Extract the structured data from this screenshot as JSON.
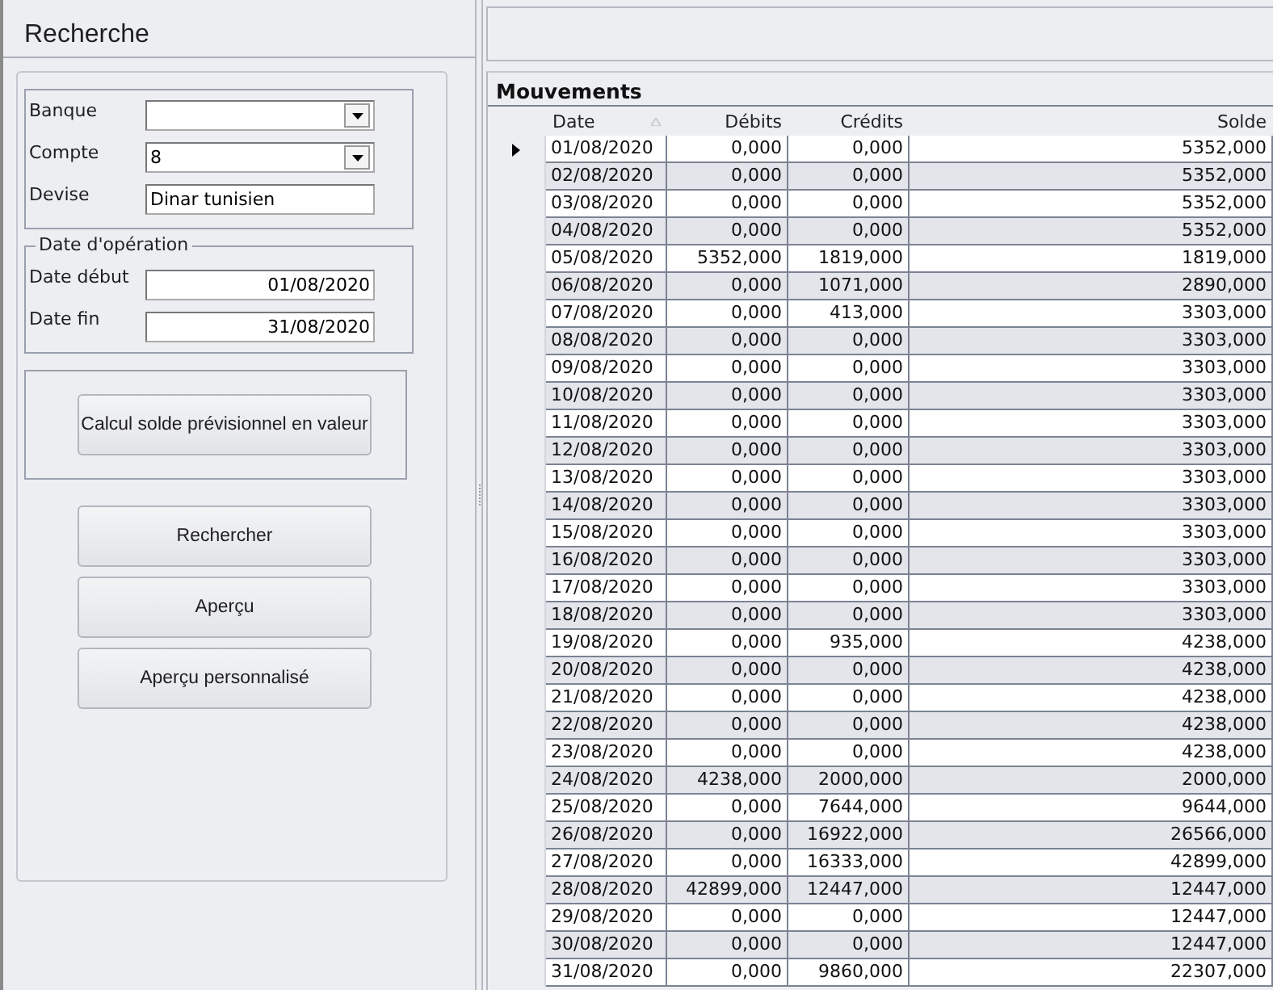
{
  "search_panel": {
    "title": "Recherche",
    "fields": [
      {
        "label": "Banque",
        "kind": "dropdown"
      },
      {
        "label": "Compte",
        "kind": "dropdown",
        "value": "8"
      },
      {
        "label": "Devise",
        "kind": "text",
        "value": "Dinar tunisien"
      }
    ],
    "date_group": {
      "legend": "Date d'opération",
      "fields": [
        {
          "label": "Date début",
          "value": "01/08/2020"
        },
        {
          "label": "Date fin",
          "value": "31/08/2020"
        }
      ]
    },
    "calc_button": "Calcul solde prévisionnel en valeur",
    "buttons": [
      "Rechercher",
      "Aperçu",
      "Aperçu personnalisé"
    ]
  },
  "table": {
    "title": "Mouvements",
    "columns": [
      "Date",
      "Débits",
      "Crédits",
      "Solde"
    ],
    "rows": [
      {
        "cells": [
          "01/08/2020",
          "0,000",
          "0,000",
          "5352,000"
        ],
        "current": true
      },
      {
        "cells": [
          "02/08/2020",
          "0,000",
          "0,000",
          "5352,000"
        ],
        "current": false
      },
      {
        "cells": [
          "03/08/2020",
          "0,000",
          "0,000",
          "5352,000"
        ],
        "current": false
      },
      {
        "cells": [
          "04/08/2020",
          "0,000",
          "0,000",
          "5352,000"
        ],
        "current": false
      },
      {
        "cells": [
          "05/08/2020",
          "5352,000",
          "1819,000",
          "1819,000"
        ],
        "current": false
      },
      {
        "cells": [
          "06/08/2020",
          "0,000",
          "1071,000",
          "2890,000"
        ],
        "current": false
      },
      {
        "cells": [
          "07/08/2020",
          "0,000",
          "413,000",
          "3303,000"
        ],
        "current": false
      },
      {
        "cells": [
          "08/08/2020",
          "0,000",
          "0,000",
          "3303,000"
        ],
        "current": false
      },
      {
        "cells": [
          "09/08/2020",
          "0,000",
          "0,000",
          "3303,000"
        ],
        "current": false
      },
      {
        "cells": [
          "10/08/2020",
          "0,000",
          "0,000",
          "3303,000"
        ],
        "current": false
      },
      {
        "cells": [
          "11/08/2020",
          "0,000",
          "0,000",
          "3303,000"
        ],
        "current": false
      },
      {
        "cells": [
          "12/08/2020",
          "0,000",
          "0,000",
          "3303,000"
        ],
        "current": false
      },
      {
        "cells": [
          "13/08/2020",
          "0,000",
          "0,000",
          "3303,000"
        ],
        "current": false
      },
      {
        "cells": [
          "14/08/2020",
          "0,000",
          "0,000",
          "3303,000"
        ],
        "current": false
      },
      {
        "cells": [
          "15/08/2020",
          "0,000",
          "0,000",
          "3303,000"
        ],
        "current": false
      },
      {
        "cells": [
          "16/08/2020",
          "0,000",
          "0,000",
          "3303,000"
        ],
        "current": false
      },
      {
        "cells": [
          "17/08/2020",
          "0,000",
          "0,000",
          "3303,000"
        ],
        "current": false
      },
      {
        "cells": [
          "18/08/2020",
          "0,000",
          "0,000",
          "3303,000"
        ],
        "current": false
      },
      {
        "cells": [
          "19/08/2020",
          "0,000",
          "935,000",
          "4238,000"
        ],
        "current": false
      },
      {
        "cells": [
          "20/08/2020",
          "0,000",
          "0,000",
          "4238,000"
        ],
        "current": false
      },
      {
        "cells": [
          "21/08/2020",
          "0,000",
          "0,000",
          "4238,000"
        ],
        "current": false
      },
      {
        "cells": [
          "22/08/2020",
          "0,000",
          "0,000",
          "4238,000"
        ],
        "current": false
      },
      {
        "cells": [
          "23/08/2020",
          "0,000",
          "0,000",
          "4238,000"
        ],
        "current": false
      },
      {
        "cells": [
          "24/08/2020",
          "4238,000",
          "2000,000",
          "2000,000"
        ],
        "current": false
      },
      {
        "cells": [
          "25/08/2020",
          "0,000",
          "7644,000",
          "9644,000"
        ],
        "current": false
      },
      {
        "cells": [
          "26/08/2020",
          "0,000",
          "16922,000",
          "26566,000"
        ],
        "current": false
      },
      {
        "cells": [
          "27/08/2020",
          "0,000",
          "16333,000",
          "42899,000"
        ],
        "current": false
      },
      {
        "cells": [
          "28/08/2020",
          "42899,000",
          "12447,000",
          "12447,000"
        ],
        "current": false
      },
      {
        "cells": [
          "29/08/2020",
          "0,000",
          "0,000",
          "12447,000"
        ],
        "current": false
      },
      {
        "cells": [
          "30/08/2020",
          "0,000",
          "0,000",
          "12447,000"
        ],
        "current": false
      },
      {
        "cells": [
          "31/08/2020",
          "0,000",
          "9860,000",
          "22307,000"
        ],
        "current": false
      }
    ]
  }
}
